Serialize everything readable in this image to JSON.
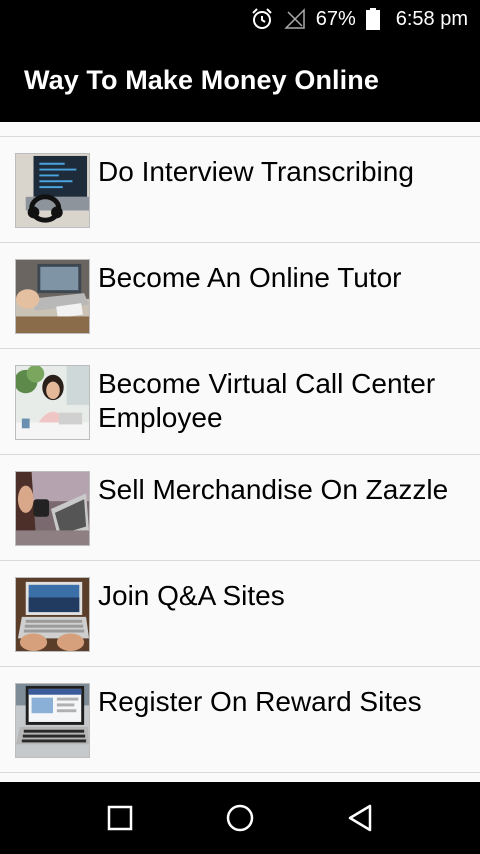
{
  "status_bar": {
    "battery_percent": "67%",
    "time": "6:58 pm",
    "icons": [
      "alarm-icon",
      "signal-icon",
      "battery-icon"
    ]
  },
  "app_bar": {
    "title": "Way To Make Money Online"
  },
  "list": {
    "items": [
      {
        "label": "Do Interview Transcribing",
        "thumbnail": "headphones-laptop-photo"
      },
      {
        "label": "Become An Online Tutor",
        "thumbnail": "laptop-desk-photo"
      },
      {
        "label": "Become Virtual Call Center Employee",
        "thumbnail": "call-center-woman-photo"
      },
      {
        "label": "Sell Merchandise On Zazzle",
        "thumbnail": "laptop-coffee-photo"
      },
      {
        "label": "Join Q&A Sites",
        "thumbnail": "laptop-typing-photo"
      },
      {
        "label": "Register On Reward Sites",
        "thumbnail": "laptop-screen-photo"
      }
    ]
  },
  "nav_bar": {
    "icons": [
      "recent-apps-icon",
      "home-icon",
      "back-icon"
    ]
  },
  "colors": {
    "bar_background": "#000000",
    "list_background": "#fafafa",
    "divider": "#d8d8d8"
  }
}
